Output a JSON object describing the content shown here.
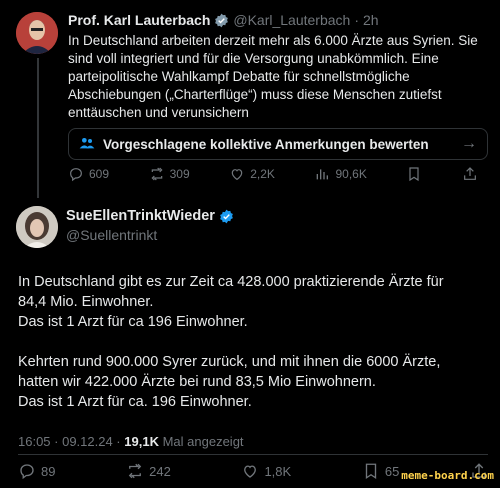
{
  "tweet1": {
    "name": "Prof. Karl Lauterbach",
    "handle": "@Karl_Lauterbach",
    "sep": "·",
    "time": "2h",
    "text": "In Deutschland arbeiten derzeit mehr als 6.000 Ärzte aus Syrien. Sie sind voll integriert und für die Versorgung unabkömmlich. Eine parteipolitische Wahlkampf Debatte für schnellstmögliche Abschiebungen („Charterflüge“) muss diese Menschen zutiefst enttäuschen und verunsichern",
    "note_label": "Vorgeschlagene kollektive Anmerkungen bewerten",
    "stats": {
      "replies": "609",
      "reposts": "309",
      "likes": "2,2K",
      "views": "90,6K"
    }
  },
  "tweet2": {
    "name": "SueEllenTrinktWieder",
    "handle": "@Suellentrinkt",
    "paragraphs": [
      "In Deutschland gibt es zur Zeit ca 428.000 praktizierende Ärzte für",
      "84,4 Mio. Einwohner.",
      "Das ist 1 Arzt für ca 196 Einwohner.",
      "Kehrten rund 900.000 Syrer zurück, und mit ihnen die 6000 Ärzte,",
      "hatten wir 422.000 Ärzte bei rund 83,5 Mio Einwohnern.",
      "Das ist 1 Arzt für ca. 196 Einwohner."
    ],
    "timestamp": "16:05 · 09.12.24 ·",
    "views": "19,1K",
    "views_label": "Mal angezeigt",
    "stats": {
      "replies": "89",
      "reposts": "242",
      "likes": "1,8K",
      "bookmarks": "65"
    }
  },
  "watermark": "meme-board.com",
  "colors": {
    "background": "#000000",
    "verified": "#1d9bf0",
    "muted": "#71767b",
    "text": "#e7e9ea"
  }
}
